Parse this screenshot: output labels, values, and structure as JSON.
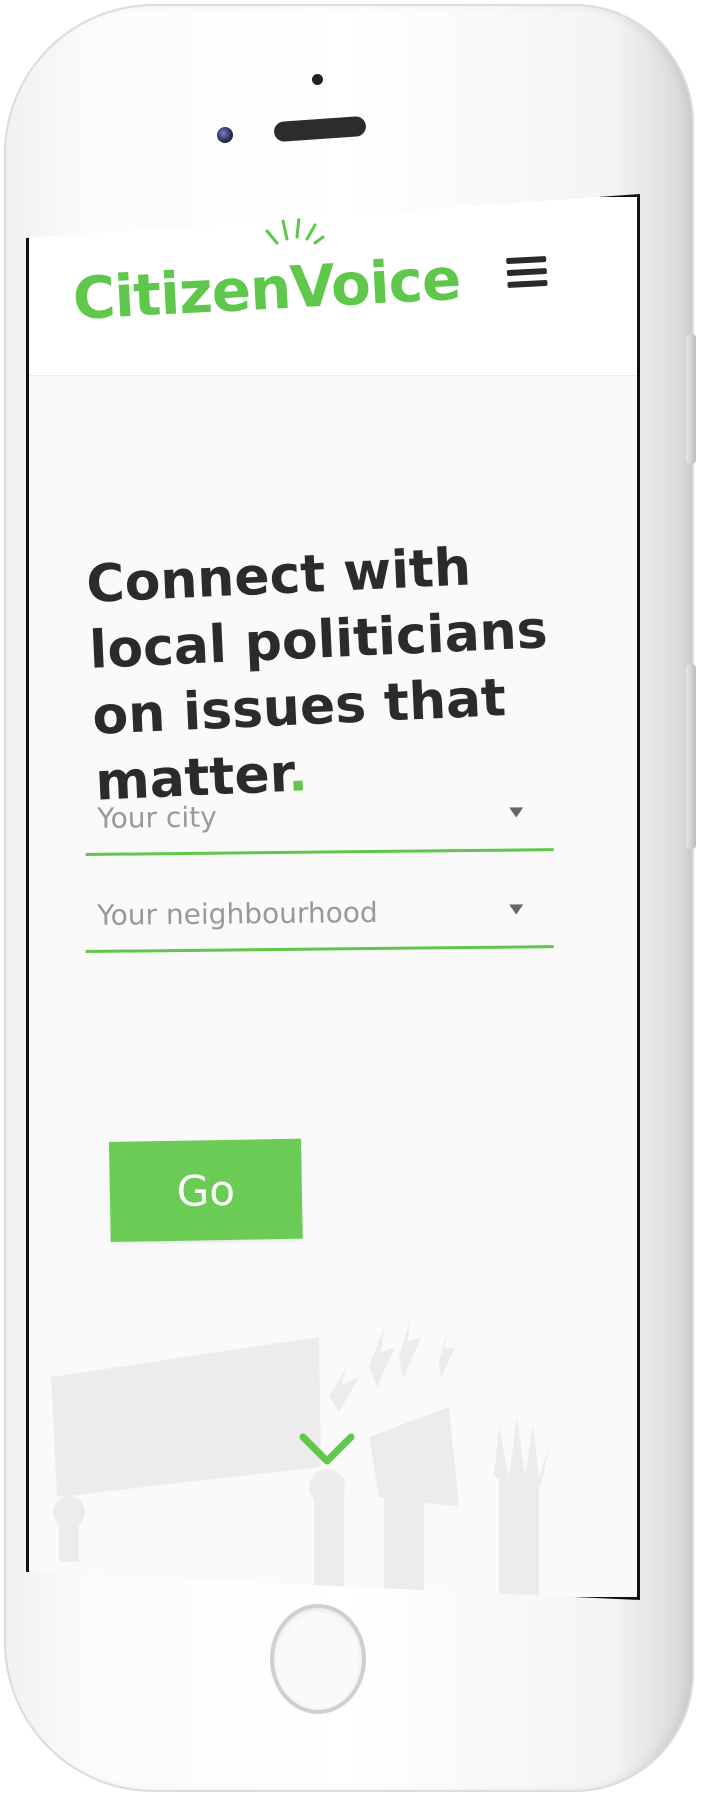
{
  "app": {
    "logo_text": "CitizenVoice"
  },
  "hero": {
    "line1": "Connect with",
    "line2": "local politicians",
    "line3": "on issues that",
    "line4": "matter",
    "end_dot": "."
  },
  "form": {
    "city_select": {
      "placeholder": "Your city"
    },
    "neighbourhood_select": {
      "placeholder": "Your neighbourhood"
    },
    "go_label": "Go"
  },
  "icons": {
    "menu": "hamburger-menu-icon",
    "caret": "caret-down-icon",
    "scroll": "chevron-down-icon",
    "logo_mark": "megaphone-icon"
  },
  "colors": {
    "brand_green": "#5fc74b",
    "button_green": "#6acc55",
    "heading": "#2b2b2b",
    "placeholder": "#999999"
  }
}
